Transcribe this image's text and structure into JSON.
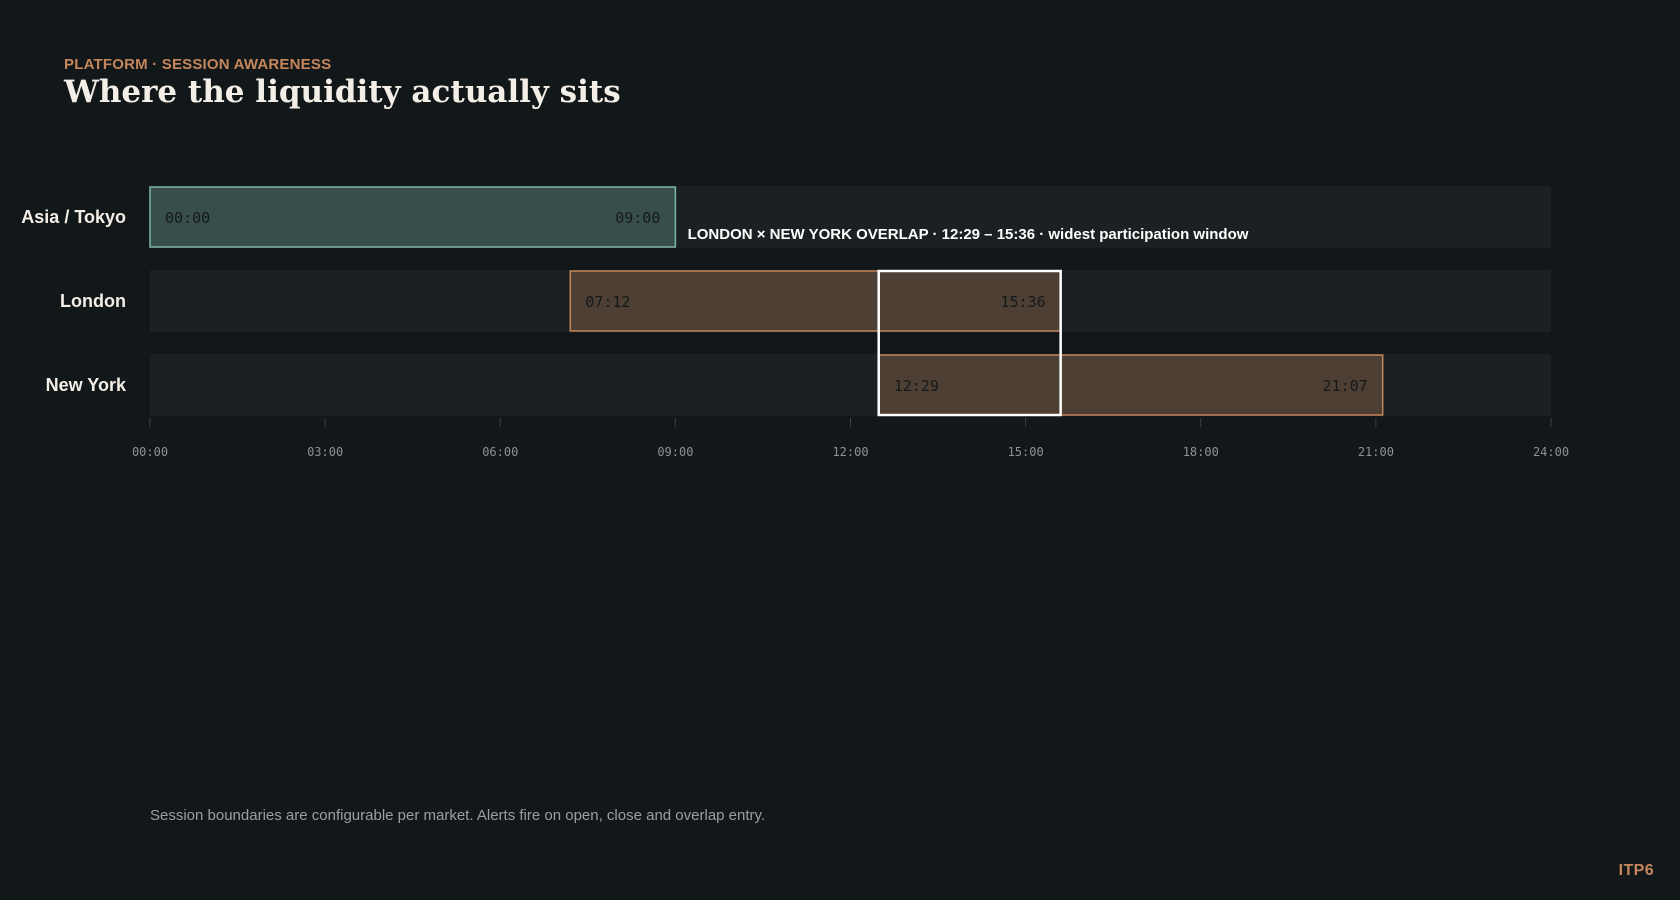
{
  "header": {
    "eyebrow": "PLATFORM · SESSION AWARENESS",
    "title": "Where the liquidity actually sits"
  },
  "chart_data": {
    "type": "bar",
    "title": "Where the liquidity actually sits",
    "xlabel": "",
    "ylabel": "",
    "xlim": [
      "00:00",
      "24:00"
    ],
    "x_ticks": [
      "00:00",
      "03:00",
      "06:00",
      "09:00",
      "12:00",
      "15:00",
      "18:00",
      "21:00",
      "24:00"
    ],
    "categories": [
      "Asia / Tokyo",
      "London",
      "New York"
    ],
    "series": [
      {
        "category": "Asia / Tokyo",
        "start": "00:00",
        "end": "09:00",
        "color": "#7fb7a6"
      },
      {
        "category": "London",
        "start": "07:12",
        "end": "15:36",
        "color": "#c5865b"
      },
      {
        "category": "New York",
        "start": "12:29",
        "end": "21:07",
        "color": "#c5865b"
      }
    ],
    "overlap": {
      "start": "12:29",
      "end": "15:36",
      "label": "LONDON × NEW YORK OVERLAP  ·  12:29 – 15:36  ·  widest participation window",
      "color": "#ffffff"
    },
    "grid": false,
    "legend": "none"
  },
  "footer": {
    "note": "Session boundaries are configurable per market. Alerts fire on open, close and overlap entry.",
    "brand": "ITP6"
  },
  "colors": {
    "background": "#12171a",
    "track": "#1b2123",
    "accent": "#c5865b",
    "asia": "#7fb7a6",
    "text": "#f4efe6"
  }
}
